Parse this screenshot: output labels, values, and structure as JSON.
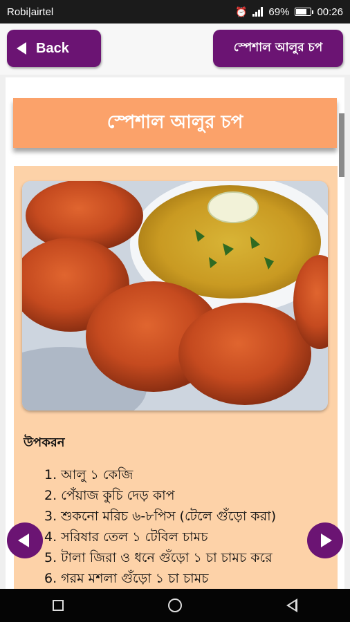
{
  "status_bar": {
    "carrier": "Robi|airtel",
    "battery": "69%",
    "time": "00:26"
  },
  "header": {
    "back_label": "Back",
    "title_button": "স্পেশাল আলুর চপ"
  },
  "recipe": {
    "title": "স্পেশাল আলুর চপ",
    "ingredients_heading": "উপকরন",
    "ingredients": [
      "1. আলু ১ কেজি",
      "2. পেঁয়াজ কুচি দেড় কাপ",
      "3. শুকনো মরিচ ৬-৮পিস (টেলে গুঁড়ো করা)",
      "4. সরিষার তেল ১ টেবিল চামচ",
      "5. টালা জিরা ও ধনে গুঁড়ো ১ চা চামচ করে",
      "6. গরম মশলা গুঁড়ো ১ চা চামচ"
    ]
  },
  "icons": {
    "back": "arrow-left-icon",
    "prev": "chevron-left-icon",
    "next": "chevron-right-icon",
    "alarm": "alarm-icon",
    "signal": "signal-icon",
    "battery": "battery-icon"
  },
  "colors": {
    "accent": "#6b1473",
    "title_bar": "#fba26a",
    "card_bg": "#fdd2a8"
  }
}
